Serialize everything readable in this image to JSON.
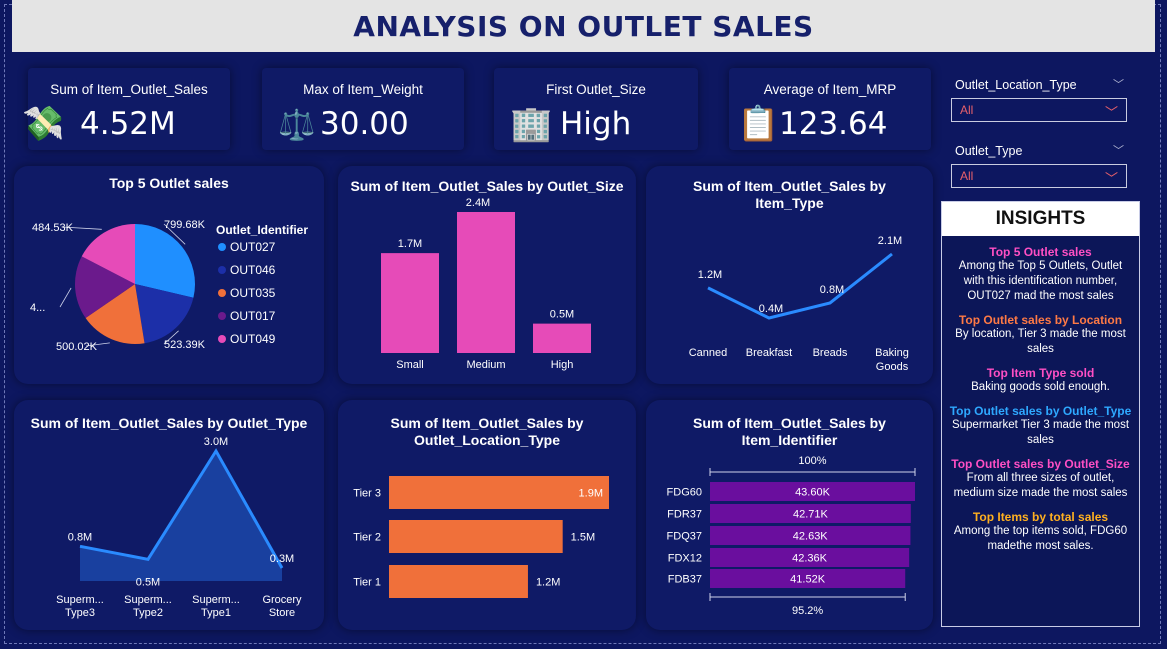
{
  "title": "ANALYSIS ON OUTLET SALES",
  "kpis": [
    {
      "label": "Sum of Item_Outlet_Sales",
      "value": "4.52M",
      "icon": "money-icon"
    },
    {
      "label": "Max of Item_Weight",
      "value": "30.00",
      "icon": "scale-icon"
    },
    {
      "label": "First Outlet_Size",
      "value": "High",
      "icon": "building-icon"
    },
    {
      "label": "Average of Item_MRP",
      "value": "123.64",
      "icon": "clipboard-icon"
    }
  ],
  "slicers": [
    {
      "label": "Outlet_Location_Type",
      "value": "All"
    },
    {
      "label": "Outlet_Type",
      "value": "All"
    }
  ],
  "insights": {
    "heading": "INSIGHTS",
    "items": [
      {
        "h": "Top 5 Outlet sales",
        "color": "#ff4fc4",
        "t": "Among the Top 5 Outlets, Outlet with this identification number, OUT027 mad the most sales"
      },
      {
        "h": "Top Outlet sales by Location",
        "color": "#ff7a45",
        "t": "By location, Tier 3 made the most sales"
      },
      {
        "h": "Top Item Type sold",
        "color": "#ff4fc4",
        "t": "Baking goods sold enough."
      },
      {
        "h": "Top Outlet sales by Outlet_Type",
        "color": "#2ea8ff",
        "t": "Supermarket Tier 3 made the most sales"
      },
      {
        "h": "Top Outlet sales by Outlet_Size",
        "color": "#ff4fc4",
        "t": "From all three sizes of outlet, medium size made the most sales"
      },
      {
        "h": "Top Items by total sales",
        "color": "#ffb020",
        "t": "Among the top items sold, FDG60 madethe most sales."
      }
    ]
  },
  "chart_data": [
    {
      "type": "pie",
      "title": "Top 5 Outlet sales",
      "legend_title": "Outlet_Identifier",
      "legend_position": "right",
      "categories": [
        "OUT027",
        "OUT046",
        "OUT035",
        "OUT017",
        "OUT049"
      ],
      "values": [
        799.68,
        523.39,
        500.02,
        480.0,
        484.53
      ],
      "labels": [
        "799.68K",
        "523.39K",
        "500.02K",
        "4...",
        "484.53K"
      ],
      "colors": [
        "#1f8fff",
        "#1c2fa8",
        "#f0703a",
        "#6b1a8c",
        "#e64bb8"
      ]
    },
    {
      "type": "bar",
      "title": "Sum of Item_Outlet_Sales by Outlet_Size",
      "categories": [
        "Small",
        "Medium",
        "High"
      ],
      "values": [
        1.7,
        2.4,
        0.5
      ],
      "labels": [
        "1.7M",
        "2.4M",
        "0.5M"
      ],
      "color": "#e64bb8",
      "ylim": [
        0,
        2.4
      ]
    },
    {
      "type": "line",
      "title": "Sum of Item_Outlet_Sales by Item_Type",
      "categories": [
        "Canned",
        "Breakfast",
        "Breads",
        "Baking Goods"
      ],
      "values": [
        1.2,
        0.4,
        0.8,
        2.1
      ],
      "labels": [
        "1.2M",
        "0.4M",
        "0.8M",
        "2.1M"
      ],
      "color": "#2a8bff"
    },
    {
      "type": "area",
      "title": "Sum of Item_Outlet_Sales by Outlet_Type",
      "categories": [
        "Supermarket Type3",
        "Supermarket Type2",
        "Supermarket Type1",
        "Grocery Store"
      ],
      "category_lines": [
        [
          "Superm...",
          "Type3"
        ],
        [
          "Superm...",
          "Type2"
        ],
        [
          "Superm...",
          "Type1"
        ],
        [
          "Grocery",
          "Store"
        ]
      ],
      "values": [
        0.8,
        0.5,
        3.0,
        0.3
      ],
      "labels": [
        "0.8M",
        "0.5M",
        "3.0M",
        "0.3M"
      ],
      "color": "#2a8bff"
    },
    {
      "type": "bar",
      "orientation": "horizontal",
      "title": "Sum of Item_Outlet_Sales by Outlet_Location_Type",
      "categories": [
        "Tier 3",
        "Tier 2",
        "Tier 1"
      ],
      "values": [
        1.9,
        1.5,
        1.2
      ],
      "labels": [
        "1.9M",
        "1.5M",
        "1.2M"
      ],
      "color": "#f0703a"
    },
    {
      "type": "bar",
      "orientation": "horizontal",
      "title": "Sum of Item_Outlet_Sales by Item_Identifier",
      "categories": [
        "FDG60",
        "FDR37",
        "FDQ37",
        "FDX12",
        "FDB37"
      ],
      "values": [
        43.6,
        42.71,
        42.63,
        42.36,
        41.52
      ],
      "labels": [
        "43.60K",
        "42.71K",
        "42.63K",
        "42.36K",
        "41.52K"
      ],
      "color": "#6a0e9e",
      "top_annotation": "100%",
      "bottom_annotation": "95.2%"
    }
  ]
}
